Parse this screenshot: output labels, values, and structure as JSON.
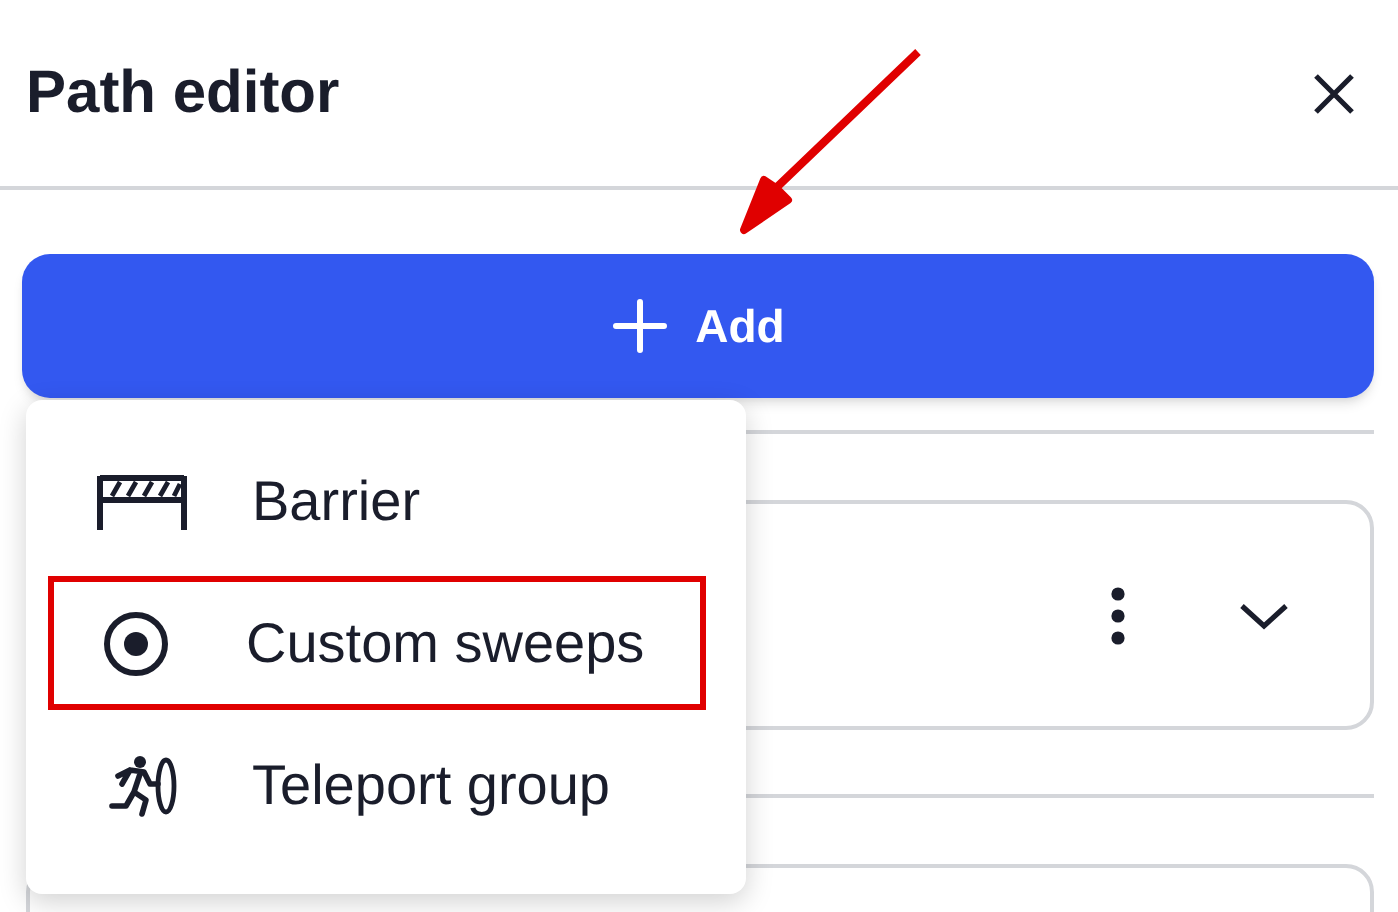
{
  "panel": {
    "title": "Path editor"
  },
  "add_button": {
    "label": "Add"
  },
  "add_menu": {
    "items": [
      {
        "kind": "barrier",
        "label": "Barrier",
        "highlighted": false
      },
      {
        "kind": "sweeps",
        "label": "Custom sweeps",
        "highlighted": true
      },
      {
        "kind": "teleport",
        "label": "Teleport group",
        "highlighted": false
      }
    ]
  }
}
